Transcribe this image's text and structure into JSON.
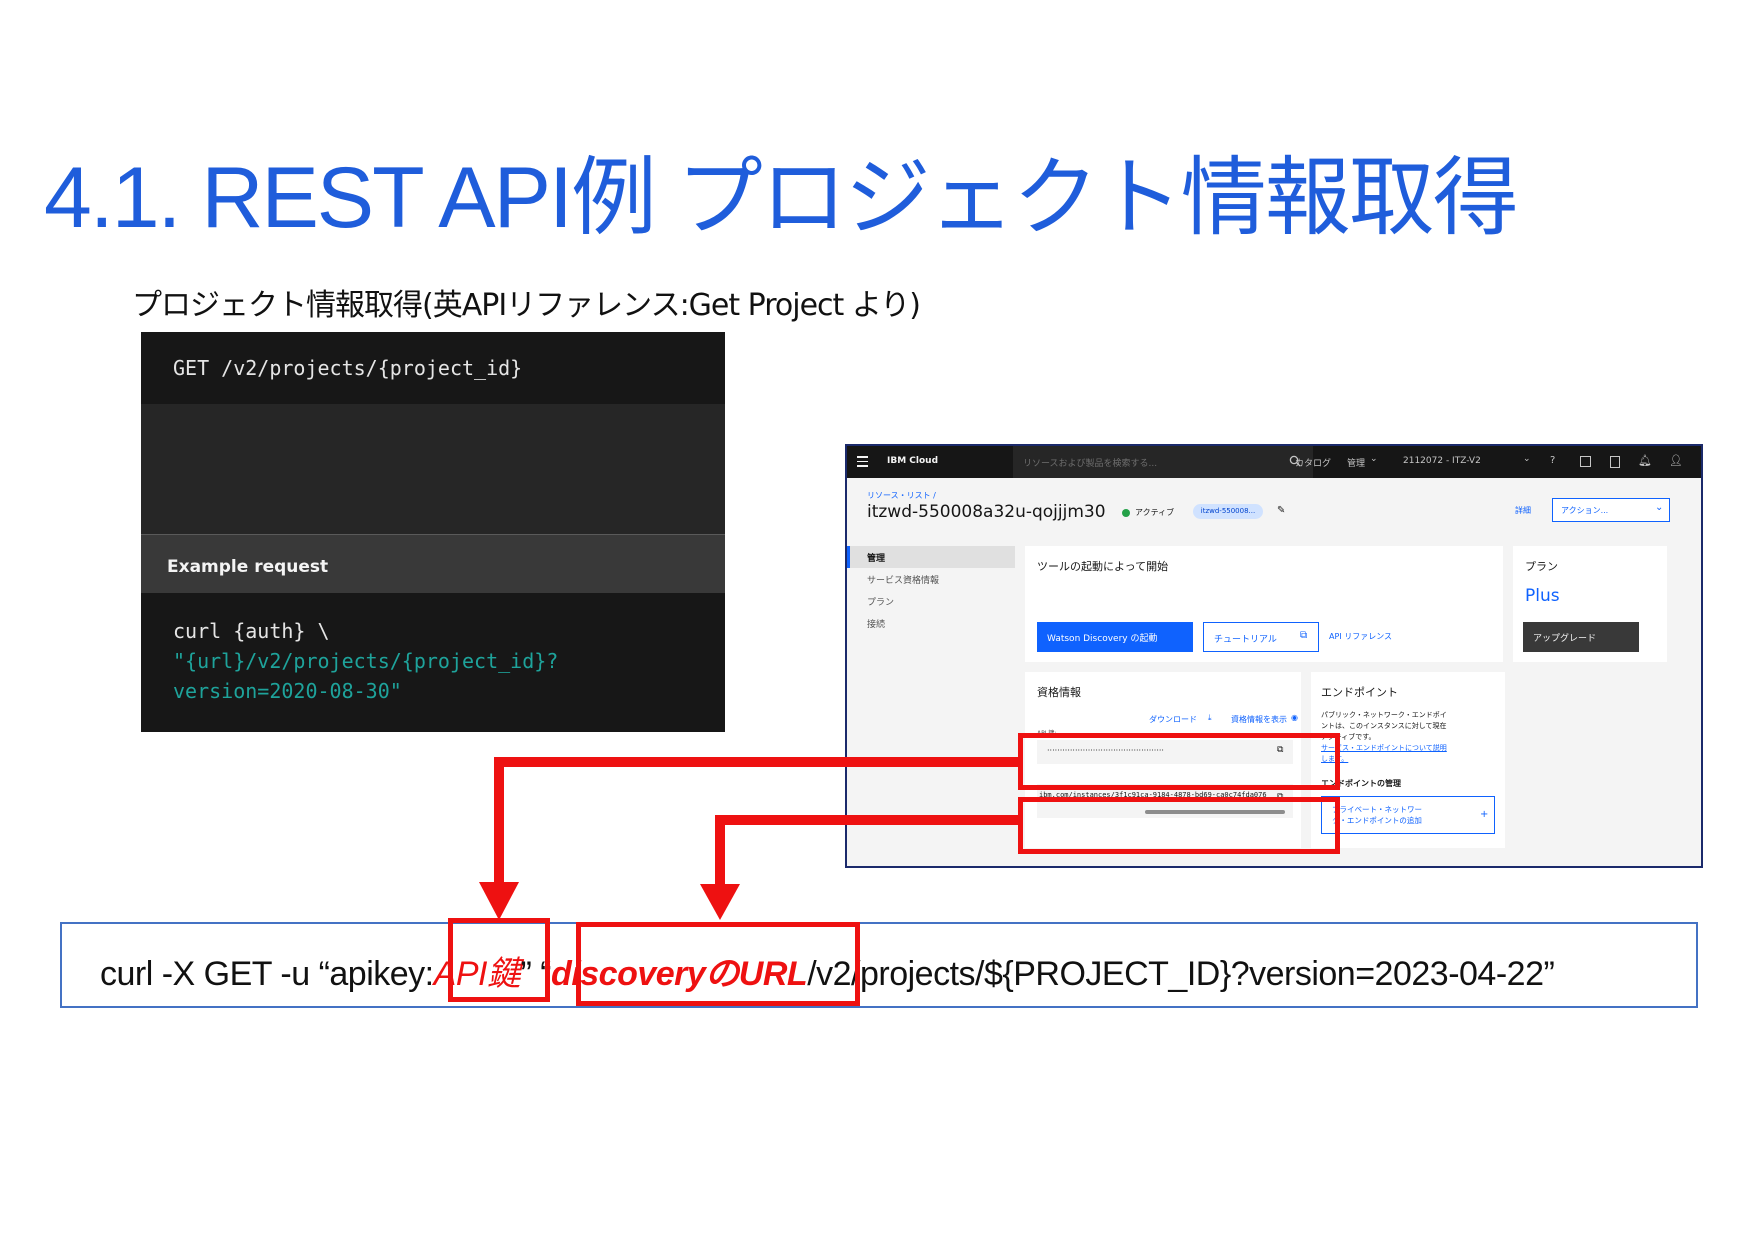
{
  "slide": {
    "title": "4.1. REST API例 プロジェクト情報取得",
    "subtitle": "プロジェクト情報取得(英APIリファレンス:Get Project より)"
  },
  "code_panel": {
    "endpoint": "GET /v2/projects/{project_id}",
    "example_label": "Example request",
    "line1": "curl {auth} \\",
    "line2": "\"{url}/v2/projects/{project_id}?",
    "line3": "version=2020-08-30\""
  },
  "cloud_console": {
    "menu_icon": "hamburger-icon",
    "brand": "IBM Cloud",
    "search_placeholder": "リソースおよび製品を検索する...",
    "nav_catalog": "カタログ",
    "nav_manage": "管理",
    "account": "2112072 - ITZ-V2",
    "breadcrumb": "リソース・リスト /",
    "instance_name": "itzwd-550008a32u-qojjjm30",
    "status": "アクティブ",
    "tag": "itzwd-550008...",
    "details_link": "詳細",
    "actions_label": "アクション...",
    "sidebar": [
      "管理",
      "サービス資格情報",
      "プラン",
      "接続"
    ],
    "tools_card": {
      "title": "ツールの起動によって開始",
      "launch_button": "Watson Discovery の起動",
      "tutorial_button": "チュートリアル",
      "api_ref_link": "API リファレンス"
    },
    "plan_card": {
      "title": "プラン",
      "plan": "Plus",
      "upgrade_button": "アップグレード"
    },
    "credentials_card": {
      "title": "資格情報",
      "download_link": "ダウンロード",
      "show_link": "資格情報を表示",
      "api_key_label": "API 鍵:",
      "api_key_value": "··············································",
      "url_value": "ibm.com/instances/3f1c91ca-9184-4878-bd69-ca0c74fda076"
    },
    "endpoint_card": {
      "title": "エンドポイント",
      "desc1": "パブリック・ネットワーク・エンドポイ",
      "desc2": "ントは、このインスタンスに対して現在",
      "desc3": "アクティブです。",
      "link1": "サービス・エンドポイントについて説明",
      "link2": "します。",
      "manage_title": "エンドポイントの管理",
      "private_button_line1": "プライベート・ネットワー",
      "private_button_line2": "ク・エンドポイントの追加",
      "plus": "+"
    }
  },
  "command": {
    "prefix": "curl -X GET -u “apikey:",
    "api_key": "API鍵",
    "mid": "” “",
    "url": "discoveryのURL",
    "suffix": "/v2/projects/${PROJECT_ID}?version=2023-04-22”"
  },
  "colors": {
    "title": "#1f5ddb",
    "highlight": "#ee1111",
    "command_border": "#4472c4"
  }
}
